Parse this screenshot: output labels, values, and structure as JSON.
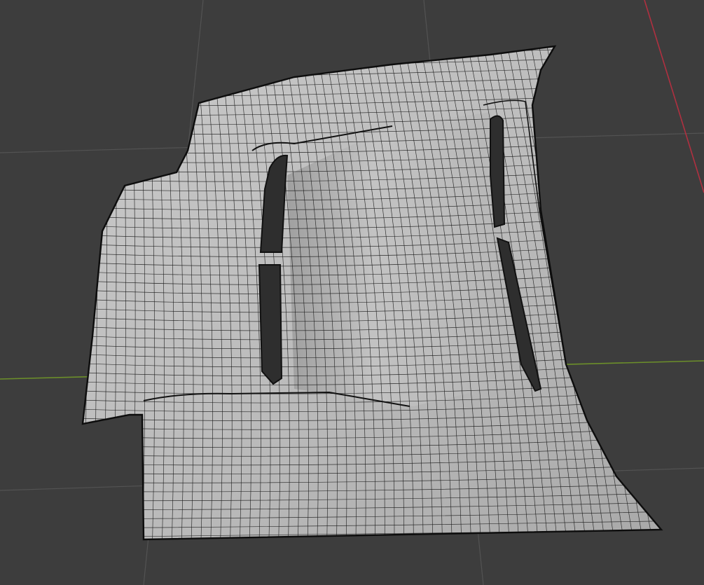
{
  "viewport": {
    "background_color": "#3d3d3d",
    "grid_color": "#535353",
    "x_axis_color": "#b03040",
    "y_axis_color": "#6c8f2a"
  },
  "mesh": {
    "fill_color": "#bcbcbc",
    "wire_color": "#1a1a1a",
    "hole_color": "#2e2e2e"
  }
}
